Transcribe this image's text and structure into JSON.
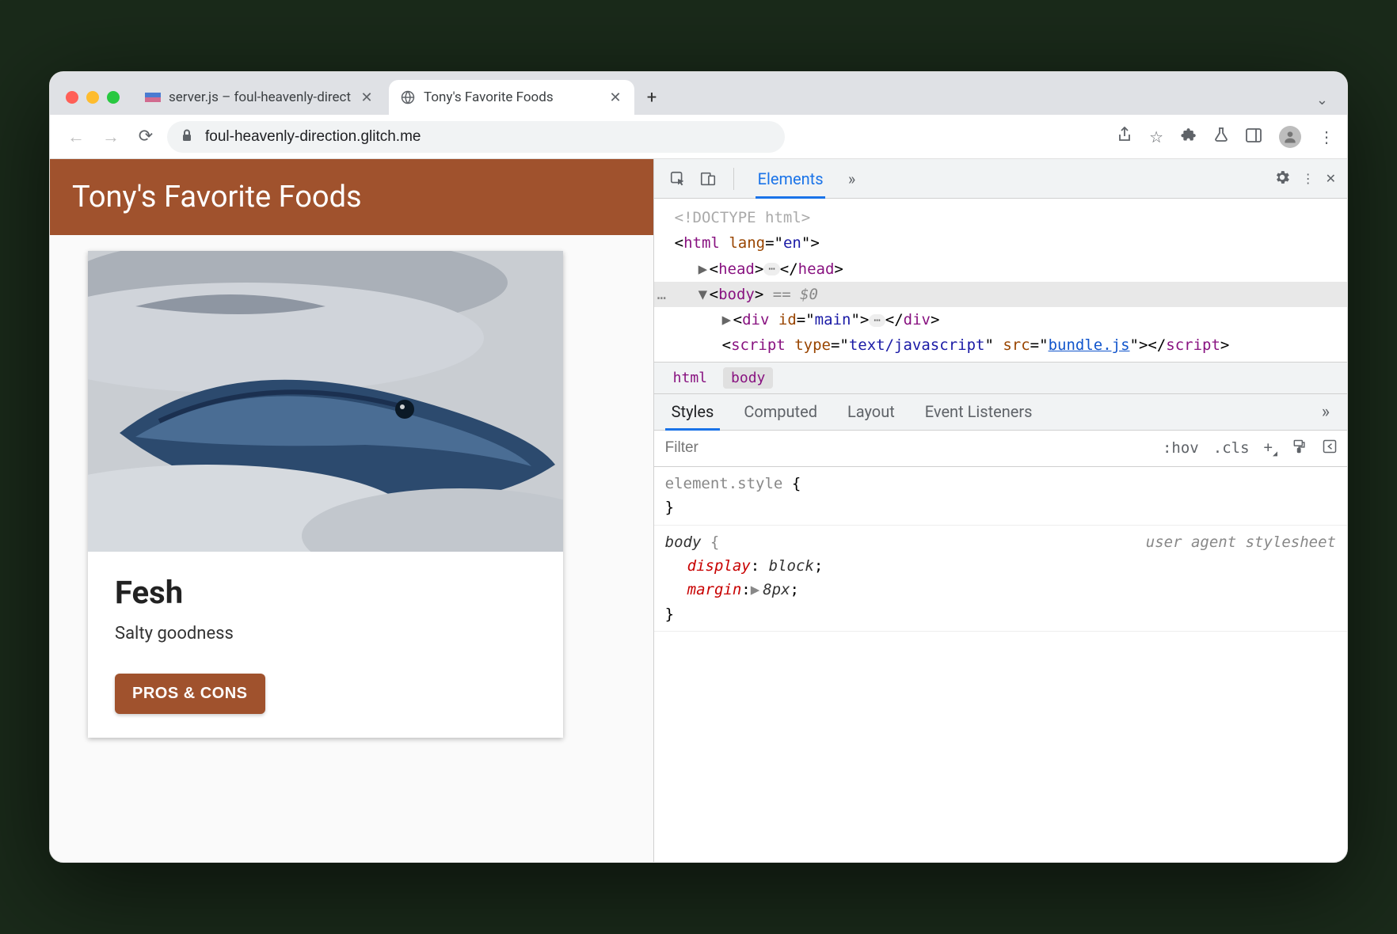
{
  "browser": {
    "tabs": [
      {
        "title": "server.js – foul-heavenly-direct",
        "active": false
      },
      {
        "title": "Tony's Favorite Foods",
        "active": true
      }
    ],
    "url": "foul-heavenly-direction.glitch.me"
  },
  "page": {
    "heading": "Tony's Favorite Foods",
    "card": {
      "title": "Fesh",
      "description": "Salty goodness",
      "button": "PROS & CONS"
    }
  },
  "devtools": {
    "main_tab": "Elements",
    "dom": {
      "doctype": "<!DOCTYPE html>",
      "html_open": "html",
      "html_attr_name": "lang",
      "html_attr_val": "en",
      "head": "head",
      "body": "body",
      "sel_marker": "== $0",
      "div_tag": "div",
      "div_attr_name": "id",
      "div_attr_val": "main",
      "script_tag": "script",
      "script_type_n": "type",
      "script_type_v": "text/javascript",
      "script_src_n": "src",
      "script_src_v": "bundle.js"
    },
    "breadcrumb": [
      "html",
      "body"
    ],
    "styles": {
      "tabs": [
        "Styles",
        "Computed",
        "Layout",
        "Event Listeners"
      ],
      "filter_placeholder": "Filter",
      "hov": ":hov",
      "cls": ".cls",
      "rules": {
        "element_style": {
          "selector": "element.style",
          "open": "{",
          "close": "}"
        },
        "body_rule": {
          "selector": "body",
          "source": "user agent stylesheet",
          "props": [
            {
              "name": "display",
              "value": "block"
            },
            {
              "name": "margin",
              "value": "8px",
              "expandable": true
            }
          ]
        }
      }
    }
  }
}
